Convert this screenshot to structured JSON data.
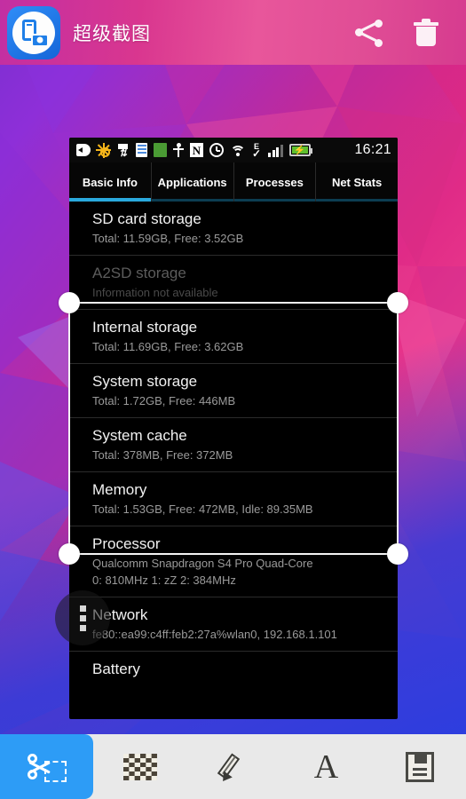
{
  "header": {
    "app_title": "超级截图",
    "app_icon": "screenshot-app-icon",
    "share_icon": "share-icon",
    "delete_icon": "trash-icon",
    "accent": "#d9368f"
  },
  "screenshot": {
    "statusbar": {
      "time": "16:21",
      "icons": [
        "back-icon",
        "brightness-icon",
        "sync-icon",
        "document-icon",
        "green-square-icon",
        "usb-icon",
        "nfc-icon",
        "alarm-icon",
        "wifi-icon",
        "edge-network-icon",
        "signal-icon",
        "battery-charging-icon"
      ],
      "nfc_glyph": "N",
      "edge_glyph": "E",
      "battery_glyph": "⚡"
    },
    "tabs": [
      {
        "label": "Basic Info",
        "active": true
      },
      {
        "label": "Applications",
        "active": false
      },
      {
        "label": "Processes",
        "active": false
      },
      {
        "label": "Net Stats",
        "active": false
      }
    ],
    "active_tab_color": "#2aa9dd",
    "rows": [
      {
        "title": "SD card storage",
        "sub": "Total: 11.59GB, Free: 3.52GB",
        "dim": false
      },
      {
        "title": "A2SD storage",
        "sub": "Information not available",
        "dim": true
      },
      {
        "title": "Internal storage",
        "sub": "Total: 11.69GB, Free: 3.62GB",
        "dim": false
      },
      {
        "title": "System storage",
        "sub": "Total: 1.72GB, Free: 446MB",
        "dim": false
      },
      {
        "title": "System cache",
        "sub": "Total: 378MB, Free: 372MB",
        "dim": false
      },
      {
        "title": "Memory",
        "sub": "Total: 1.53GB, Free: 472MB, Idle: 89.35MB",
        "dim": false
      },
      {
        "title": "Processor",
        "sub": "Qualcomm Snapdragon S4 Pro Quad-Core\n0: 810MHz  1: zZ  2: 384MHz",
        "dim": false
      },
      {
        "title": "Network",
        "sub": "fe80::ea99:c4ff:feb2:27a%wlan0, 192.168.1.101",
        "dim": false
      },
      {
        "title": "Battery",
        "sub": "",
        "dim": false
      }
    ]
  },
  "floating_menu": {
    "icon": "more-vertical-icon"
  },
  "toolbar": [
    {
      "name": "crop",
      "icon": "crop-scissors-icon",
      "active": true
    },
    {
      "name": "mosaic",
      "icon": "mosaic-icon",
      "active": false
    },
    {
      "name": "draw",
      "icon": "pencil-icon",
      "active": false
    },
    {
      "name": "text",
      "icon": "text-icon",
      "glyph": "A",
      "active": false
    },
    {
      "name": "save",
      "icon": "save-floppy-icon",
      "active": false
    }
  ],
  "toolbar_active_color": "#2d9cf6"
}
